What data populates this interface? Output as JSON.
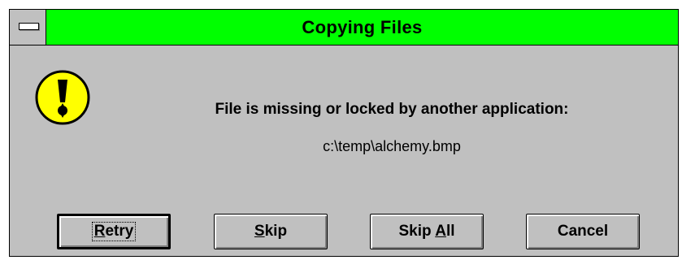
{
  "window": {
    "title": "Copying Files",
    "title_color": "#00ff00",
    "face_color": "#c0c0c0"
  },
  "icon": {
    "name": "exclamation-icon",
    "color": "#ffff00"
  },
  "message": "File is missing or locked by another application:",
  "file_path": "c:\\temp\\alchemy.bmp",
  "buttons": {
    "retry": {
      "mnemonic": "R",
      "rest": "etry"
    },
    "skip": {
      "mnemonic": "S",
      "rest": "kip"
    },
    "skip_all": {
      "pre": "Skip ",
      "mnemonic": "A",
      "rest": "ll"
    },
    "cancel": {
      "label": "Cancel"
    }
  }
}
